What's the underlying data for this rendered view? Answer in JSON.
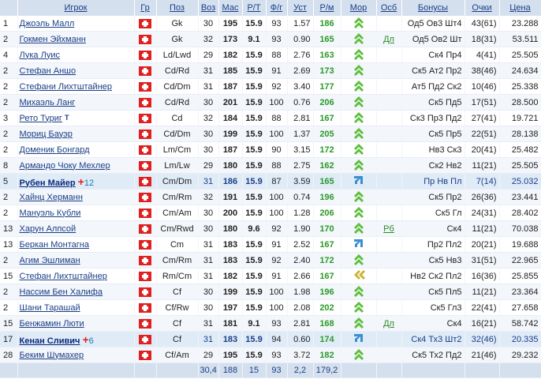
{
  "headers": {
    "num": "",
    "player": "Игрок",
    "country": "Гр",
    "pos": "Поз",
    "age": "Воз",
    "mas": "Мас",
    "rt": "Р/Т",
    "fg": "Ф/г",
    "ust": "Уст",
    "rm": "Р/м",
    "mor": "Мор",
    "osb": "Осб",
    "bonuses": "Бонусы",
    "points": "Очки",
    "price": "Цена"
  },
  "rows": [
    {
      "num": "1",
      "name": "Джоэль Малл",
      "pos": "Gk",
      "age": "30",
      "mas": "195",
      "rt": "15.9",
      "fg": "93",
      "ust": "1.57",
      "rm": "186",
      "mor": "up",
      "osb": "",
      "bonus": "Од5 Ов3 Шт4",
      "points": "43(61)",
      "price": "23.288"
    },
    {
      "num": "2",
      "name": "Гокмен Эйхманн",
      "pos": "Gk",
      "age": "32",
      "mas": "173",
      "rt": "9.1",
      "fg": "93",
      "ust": "0.90",
      "rm": "165",
      "mor": "up",
      "osb": "Дл",
      "bonus": "Од5 Ов2 Шт",
      "points": "18(31)",
      "price": "53.511"
    },
    {
      "num": "4",
      "name": "Лука Луис",
      "pos": "Ld/Lwd",
      "age": "29",
      "mas": "182",
      "rt": "15.9",
      "fg": "88",
      "ust": "2.76",
      "rm": "163",
      "mor": "up",
      "osb": "",
      "bonus": "Ск4 Пр4",
      "points": "4(41)",
      "price": "25.505"
    },
    {
      "num": "2",
      "name": "Стефан Аншо",
      "pos": "Cd/Rd",
      "age": "31",
      "mas": "185",
      "rt": "15.9",
      "fg": "91",
      "ust": "2.69",
      "rm": "173",
      "mor": "up",
      "osb": "",
      "bonus": "Ск5 Ат2 Пр2",
      "points": "38(46)",
      "price": "24.634"
    },
    {
      "num": "2",
      "name": "Стефани Лихтштайнер",
      "pos": "Cd/Dm",
      "age": "31",
      "mas": "187",
      "rt": "15.9",
      "fg": "92",
      "ust": "3.40",
      "rm": "177",
      "mor": "up",
      "osb": "",
      "bonus": "Ат5 Пд2 Ск2",
      "points": "10(46)",
      "price": "25.338"
    },
    {
      "num": "2",
      "name": "Михаэль Ланг",
      "pos": "Cd/Rd",
      "age": "30",
      "mas": "201",
      "rt": "15.9",
      "fg": "100",
      "ust": "0.76",
      "rm": "206",
      "mor": "up",
      "osb": "",
      "bonus": "Ск5 Пд5",
      "points": "17(51)",
      "price": "28.500"
    },
    {
      "num": "3",
      "name": "Рето Туриг",
      "tmark": "T",
      "pos": "Cd",
      "age": "32",
      "mas": "184",
      "rt": "15.9",
      "fg": "88",
      "ust": "2.81",
      "rm": "167",
      "mor": "up",
      "osb": "",
      "bonus": "Ск3 Пр3 Пд2",
      "points": "27(41)",
      "price": "19.721"
    },
    {
      "num": "2",
      "name": "Мориц Бауэр",
      "pos": "Cd/Dm",
      "age": "30",
      "mas": "199",
      "rt": "15.9",
      "fg": "100",
      "ust": "1.37",
      "rm": "205",
      "mor": "up",
      "osb": "",
      "bonus": "Ск5 Пр5",
      "points": "22(51)",
      "price": "28.138"
    },
    {
      "num": "2",
      "name": "Доменик Бонгард",
      "pos": "Lm/Cm",
      "age": "30",
      "mas": "187",
      "rt": "15.9",
      "fg": "90",
      "ust": "3.15",
      "rm": "172",
      "mor": "up",
      "osb": "",
      "bonus": "Нв3 Ск3",
      "points": "20(41)",
      "price": "25.482"
    },
    {
      "num": "8",
      "name": "Армандо Чоку Мехлер",
      "pos": "Lm/Lw",
      "age": "29",
      "mas": "180",
      "rt": "15.9",
      "fg": "88",
      "ust": "2.75",
      "rm": "162",
      "mor": "up",
      "osb": "",
      "bonus": "Ск2 Нв2",
      "points": "11(21)",
      "price": "25.505"
    },
    {
      "num": "5",
      "name": "Рубен Майер",
      "plus": "+",
      "extra": "12",
      "sel": true,
      "pos": "Cm/Dm",
      "age": "31",
      "mas": "186",
      "rt": "15.9",
      "fg": "87",
      "ust": "3.59",
      "rm": "165",
      "mor": "right",
      "osb": "",
      "bonus": "Пр Нв Пл",
      "points": "7(14)",
      "price": "25.032"
    },
    {
      "num": "2",
      "name": "Хайнц Херманн",
      "pos": "Cm/Rm",
      "age": "32",
      "mas": "191",
      "rt": "15.9",
      "fg": "100",
      "ust": "0.74",
      "rm": "196",
      "mor": "up",
      "osb": "",
      "bonus": "Ск5 Пр2",
      "points": "26(36)",
      "price": "23.441"
    },
    {
      "num": "2",
      "name": "Мануэль Кубли",
      "pos": "Cm/Am",
      "age": "30",
      "mas": "200",
      "rt": "15.9",
      "fg": "100",
      "ust": "1.28",
      "rm": "206",
      "mor": "up",
      "osb": "",
      "bonus": "Ск5 Гл",
      "points": "24(31)",
      "price": "28.402"
    },
    {
      "num": "13",
      "name": "Харун Алпсой",
      "pos": "Cm/Rwd",
      "age": "30",
      "mas": "180",
      "rt": "9.6",
      "fg": "92",
      "ust": "1.90",
      "rm": "170",
      "mor": "up",
      "osb": "Рб",
      "bonus": "Ск4",
      "points": "11(21)",
      "price": "70.038"
    },
    {
      "num": "13",
      "name": "Беркан Монтагна",
      "pos": "Cm",
      "age": "31",
      "mas": "183",
      "rt": "15.9",
      "fg": "91",
      "ust": "2.52",
      "rm": "167",
      "mor": "right",
      "osb": "",
      "bonus": "Пр2 Пл2",
      "points": "20(21)",
      "price": "19.688"
    },
    {
      "num": "2",
      "name": "Агим Эшлиман",
      "pos": "Cm/Rm",
      "age": "31",
      "mas": "183",
      "rt": "15.9",
      "fg": "92",
      "ust": "2.40",
      "rm": "172",
      "mor": "up",
      "osb": "",
      "bonus": "Ск5 Нв3",
      "points": "31(51)",
      "price": "22.965"
    },
    {
      "num": "15",
      "name": "Стефан Лихтштайнер",
      "pos": "Rm/Cm",
      "age": "31",
      "mas": "182",
      "rt": "15.9",
      "fg": "91",
      "ust": "2.66",
      "rm": "167",
      "mor": "left",
      "osb": "",
      "bonus": "Нв2 Ск2 Пл2",
      "points": "16(36)",
      "price": "25.855"
    },
    {
      "num": "2",
      "name": "Нассим Бен Халифа",
      "pos": "Cf",
      "age": "30",
      "mas": "199",
      "rt": "15.9",
      "fg": "100",
      "ust": "1.98",
      "rm": "196",
      "mor": "up",
      "osb": "",
      "bonus": "Ск5 Пл5",
      "points": "11(21)",
      "price": "23.364"
    },
    {
      "num": "2",
      "name": "Шани Тарашай",
      "pos": "Cf/Rw",
      "age": "30",
      "mas": "197",
      "rt": "15.9",
      "fg": "100",
      "ust": "2.08",
      "rm": "202",
      "mor": "up",
      "osb": "",
      "bonus": "Ск5 Гл3",
      "points": "22(41)",
      "price": "27.658"
    },
    {
      "num": "15",
      "name": "Бенжамин Люти",
      "pos": "Cf",
      "age": "31",
      "mas": "181",
      "rt": "9.1",
      "fg": "93",
      "ust": "2.81",
      "rm": "168",
      "mor": "up",
      "osb": "Дл",
      "bonus": "Ск4",
      "points": "16(21)",
      "price": "58.742"
    },
    {
      "num": "17",
      "name": "Кенан Сливич",
      "plus": "+",
      "extra": "6",
      "sel": true,
      "pos": "Cf",
      "age": "31",
      "mas": "183",
      "rt": "15.9",
      "fg": "94",
      "ust": "0.60",
      "rm": "174",
      "mor": "right",
      "osb": "",
      "bonus": "Ск4 Тх3 Шт2",
      "points": "32(46)",
      "price": "20.335"
    },
    {
      "num": "28",
      "name": "Беким Шумахер",
      "pos": "Cf/Am",
      "age": "29",
      "mas": "195",
      "rt": "15.9",
      "fg": "93",
      "ust": "3.72",
      "rm": "182",
      "mor": "up",
      "osb": "",
      "bonus": "Ск5 Тх2 Пд2",
      "points": "21(46)",
      "price": "29.232"
    }
  ],
  "footer": {
    "age": "30,4",
    "mas": "188",
    "rt": "15",
    "fg": "93",
    "ust": "2,2",
    "rm": "179,2"
  }
}
